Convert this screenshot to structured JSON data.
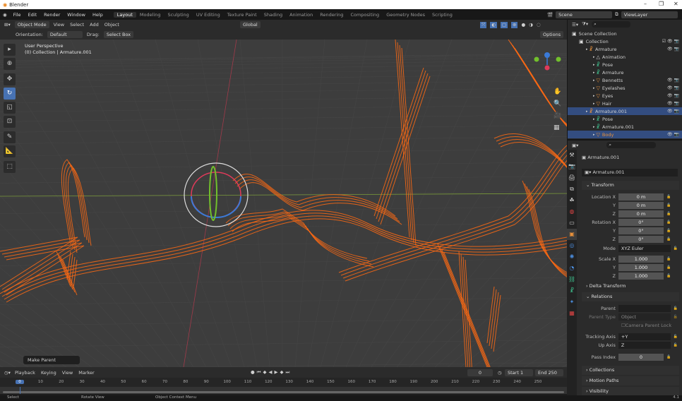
{
  "window": {
    "title": "Blender",
    "controls": [
      "–",
      "❐",
      "✕"
    ]
  },
  "menu": [
    "File",
    "Edit",
    "Render",
    "Window",
    "Help"
  ],
  "workspaces": [
    {
      "label": "Layout",
      "active": true
    },
    {
      "label": "Modeling"
    },
    {
      "label": "Sculpting"
    },
    {
      "label": "UV Editing"
    },
    {
      "label": "Texture Paint"
    },
    {
      "label": "Shading"
    },
    {
      "label": "Animation"
    },
    {
      "label": "Rendering"
    },
    {
      "label": "Compositing"
    },
    {
      "label": "Geometry Nodes"
    },
    {
      "label": "Scripting"
    }
  ],
  "scene": {
    "label": "Scene",
    "view_layer": "ViewLayer"
  },
  "viewport_header": {
    "mode": "Object Mode",
    "menus": [
      "View",
      "Select",
      "Add",
      "Object"
    ],
    "transform": "Global",
    "options": "Options"
  },
  "tool_settings": {
    "orientation_label": "Orientation:",
    "orientation": "Default",
    "drag_label": "Drag:",
    "drag": "Select Box"
  },
  "viewport": {
    "view_name": "User Perspective",
    "context": "(0) Collection | Armature.001",
    "last_operator": "Make Parent"
  },
  "tools": [
    {
      "icon": "cursor-select-icon",
      "glyph": "▸"
    },
    {
      "icon": "3d-cursor-icon",
      "glyph": "⊕"
    },
    {
      "icon": "move-icon",
      "glyph": "✥"
    },
    {
      "icon": "rotate-icon",
      "glyph": "↻",
      "active": true
    },
    {
      "icon": "scale-icon",
      "glyph": "◱"
    },
    {
      "icon": "transform-icon",
      "glyph": "⊡"
    },
    {
      "icon": "annotate-icon",
      "glyph": "✎"
    },
    {
      "icon": "measure-icon",
      "glyph": "📐"
    },
    {
      "icon": "add-cube-icon",
      "glyph": "⬚"
    }
  ],
  "outliner": {
    "search_placeholder": "",
    "rows": [
      {
        "label": "Scene Collection",
        "indent": 0,
        "icon": "▣",
        "color": "#ddd"
      },
      {
        "label": "Collection",
        "indent": 1,
        "icon": "▣",
        "color": "#ddd",
        "vis": "☑ 👁 📷"
      },
      {
        "label": "Armature",
        "indent": 2,
        "icon": "☧",
        "color": "#e8913b",
        "vis": "👁 📷"
      },
      {
        "label": "Animation",
        "indent": 3,
        "icon": "△",
        "color": "#ccc"
      },
      {
        "label": "Pose",
        "indent": 3,
        "icon": "☧",
        "color": "#3ec28f"
      },
      {
        "label": "Armature",
        "indent": 3,
        "icon": "☧",
        "color": "#3ec28f"
      },
      {
        "label": "Bennetts",
        "indent": 3,
        "icon": "▽",
        "color": "#e8913b",
        "vis": "👁 📷"
      },
      {
        "label": "Eyelashes",
        "indent": 3,
        "icon": "▽",
        "color": "#e8913b",
        "vis": "👁 📷"
      },
      {
        "label": "Eyes",
        "indent": 3,
        "icon": "▽",
        "color": "#e8913b",
        "vis": "👁 📷"
      },
      {
        "label": "Hair",
        "indent": 3,
        "icon": "▽",
        "color": "#e8913b",
        "vis": "👁 📷"
      },
      {
        "label": "Armature.001",
        "indent": 2,
        "icon": "☧",
        "color": "#e8913b",
        "vis": "👁 📷",
        "selected": true
      },
      {
        "label": "Pose",
        "indent": 3,
        "icon": "☧",
        "color": "#3ec28f"
      },
      {
        "label": "Armature.001",
        "indent": 3,
        "icon": "☧",
        "color": "#3ec28f"
      },
      {
        "label": "Body",
        "indent": 3,
        "icon": "▽",
        "color": "#e8913b",
        "vis": "👁 📷",
        "selected": true,
        "label_color": "#e8913b"
      }
    ]
  },
  "properties": {
    "object_name": "Armature.001",
    "data_name": "Armature.001",
    "transform": {
      "title": "Transform",
      "location_label": "Location X",
      "location": [
        "0 m",
        "0 m",
        "0 m"
      ],
      "rotation_label": "Rotation X",
      "rotation": [
        "0°",
        "0°",
        "0°"
      ],
      "mode_label": "Mode",
      "mode": "XYZ Euler",
      "scale_label": "Scale X",
      "scale": [
        "1.000",
        "1.000",
        "1.000"
      ],
      "delta": "Delta Transform",
      "y": "Y",
      "z": "Z"
    },
    "relations": {
      "title": "Relations",
      "parent_label": "Parent",
      "parent_type_label": "Parent Type",
      "parent_type": "Object",
      "camera_lock": "Camera Parent Lock",
      "tracking_label": "Tracking Axis",
      "tracking": "+Y",
      "up_label": "Up Axis",
      "up": "Z",
      "pass_label": "Pass Index",
      "pass": "0"
    },
    "collapsed": [
      "Collections",
      "Motion Paths",
      "Visibility"
    ]
  },
  "timeline": {
    "menus": [
      "Playback",
      "Keying",
      "View",
      "Marker"
    ],
    "current_frame": "0",
    "start_label": "Start",
    "start": "1",
    "end_label": "End",
    "end": "250",
    "ticks": [
      "0",
      "10",
      "20",
      "30",
      "40",
      "50",
      "60",
      "70",
      "80",
      "90",
      "100",
      "110",
      "120",
      "130",
      "140",
      "150",
      "160",
      "170",
      "180",
      "190",
      "200",
      "210",
      "220",
      "230",
      "240",
      "250"
    ]
  },
  "status": {
    "items": [
      "Select",
      "Rotate View",
      "Object Context Menu"
    ],
    "version": "4.1"
  },
  "colors": {
    "accent": "#4772b3",
    "wire": "#ff6a13",
    "selected_row": "#334d80"
  }
}
